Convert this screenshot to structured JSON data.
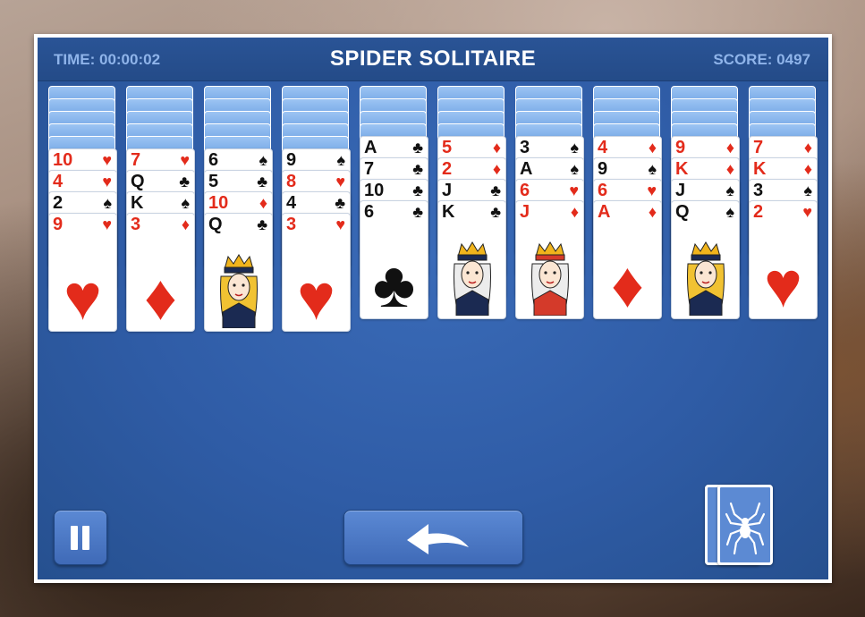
{
  "header": {
    "title": "SPIDER SOLITAIRE",
    "time": "TIME: 00:00:02",
    "score": "SCORE: 0497"
  },
  "colors": {
    "felt": "#2f5ca6",
    "topbar": "#244b88",
    "red_suit": "#e32b1b",
    "black_suit": "#111111",
    "card_back": "#76a8e6"
  },
  "tableau": [
    {
      "facedown": 5,
      "cards": [
        {
          "rank": "10",
          "suit": "♥",
          "color": "red"
        },
        {
          "rank": "4",
          "suit": "♥",
          "color": "red"
        },
        {
          "rank": "2",
          "suit": "♠",
          "color": "black"
        },
        {
          "rank": "9",
          "suit": "♥",
          "color": "red",
          "pip": "♥"
        }
      ]
    },
    {
      "facedown": 5,
      "cards": [
        {
          "rank": "7",
          "suit": "♥",
          "color": "red"
        },
        {
          "rank": "Q",
          "suit": "♣",
          "color": "black"
        },
        {
          "rank": "K",
          "suit": "♠",
          "color": "black"
        },
        {
          "rank": "3",
          "suit": "♦",
          "color": "red",
          "pip": "♦"
        }
      ]
    },
    {
      "facedown": 5,
      "cards": [
        {
          "rank": "6",
          "suit": "♠",
          "color": "black"
        },
        {
          "rank": "5",
          "suit": "♣",
          "color": "black"
        },
        {
          "rank": "10",
          "suit": "♦",
          "color": "red"
        },
        {
          "rank": "Q",
          "suit": "♣",
          "color": "black",
          "face": "queen"
        }
      ]
    },
    {
      "facedown": 5,
      "cards": [
        {
          "rank": "9",
          "suit": "♠",
          "color": "black"
        },
        {
          "rank": "8",
          "suit": "♥",
          "color": "red"
        },
        {
          "rank": "4",
          "suit": "♣",
          "color": "black"
        },
        {
          "rank": "3",
          "suit": "♥",
          "color": "red",
          "pip": "♥"
        }
      ]
    },
    {
      "facedown": 4,
      "cards": [
        {
          "rank": "A",
          "suit": "♣",
          "color": "black"
        },
        {
          "rank": "7",
          "suit": "♣",
          "color": "black"
        },
        {
          "rank": "10",
          "suit": "♣",
          "color": "black"
        },
        {
          "rank": "6",
          "suit": "♣",
          "color": "black",
          "pip": "♣"
        }
      ]
    },
    {
      "facedown": 4,
      "cards": [
        {
          "rank": "5",
          "suit": "♦",
          "color": "red"
        },
        {
          "rank": "2",
          "suit": "♦",
          "color": "red"
        },
        {
          "rank": "J",
          "suit": "♣",
          "color": "black"
        },
        {
          "rank": "K",
          "suit": "♣",
          "color": "black",
          "face": "king"
        }
      ]
    },
    {
      "facedown": 4,
      "cards": [
        {
          "rank": "3",
          "suit": "♠",
          "color": "black"
        },
        {
          "rank": "A",
          "suit": "♠",
          "color": "black"
        },
        {
          "rank": "6",
          "suit": "♥",
          "color": "red"
        },
        {
          "rank": "J",
          "suit": "♦",
          "color": "red",
          "face": "jack"
        }
      ]
    },
    {
      "facedown": 4,
      "cards": [
        {
          "rank": "4",
          "suit": "♦",
          "color": "red"
        },
        {
          "rank": "9",
          "suit": "♠",
          "color": "black"
        },
        {
          "rank": "6",
          "suit": "♥",
          "color": "red"
        },
        {
          "rank": "A",
          "suit": "♦",
          "color": "red",
          "pip": "♦"
        }
      ]
    },
    {
      "facedown": 4,
      "cards": [
        {
          "rank": "9",
          "suit": "♦",
          "color": "red"
        },
        {
          "rank": "K",
          "suit": "♦",
          "color": "red"
        },
        {
          "rank": "J",
          "suit": "♠",
          "color": "black"
        },
        {
          "rank": "Q",
          "suit": "♠",
          "color": "black",
          "face": "queen"
        }
      ]
    },
    {
      "facedown": 4,
      "cards": [
        {
          "rank": "7",
          "suit": "♦",
          "color": "red"
        },
        {
          "rank": "K",
          "suit": "♦",
          "color": "red"
        },
        {
          "rank": "3",
          "suit": "♠",
          "color": "black"
        },
        {
          "rank": "2",
          "suit": "♥",
          "color": "red",
          "pip": "♥"
        }
      ]
    }
  ],
  "controls": {
    "pause_icon": "pause-icon",
    "undo_icon": "undo-arrow-icon",
    "stock_icon": "spider-icon",
    "stock_piles": 2
  }
}
